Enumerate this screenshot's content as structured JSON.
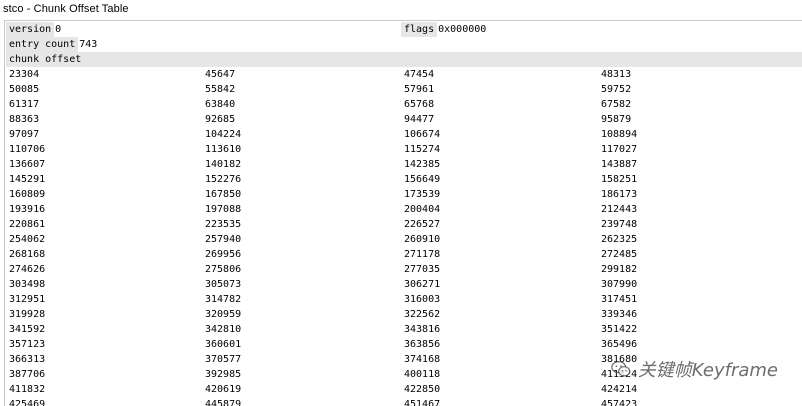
{
  "window": {
    "title": "stco - Chunk Offset Table"
  },
  "header": {
    "version_label": "version",
    "version_value": "0",
    "flags_label": "flags",
    "flags_value": "0x000000",
    "entry_count_label": "entry count",
    "entry_count_value": "743",
    "chunk_offset_label": "chunk offset"
  },
  "table": {
    "rows": [
      [
        "23304",
        "45647",
        "47454",
        "48313"
      ],
      [
        "50085",
        "55842",
        "57961",
        "59752"
      ],
      [
        "61317",
        "63840",
        "65768",
        "67582"
      ],
      [
        "88363",
        "92685",
        "94477",
        "95879"
      ],
      [
        "97097",
        "104224",
        "106674",
        "108894"
      ],
      [
        "110706",
        "113610",
        "115274",
        "117027"
      ],
      [
        "136607",
        "140182",
        "142385",
        "143887"
      ],
      [
        "145291",
        "152276",
        "156649",
        "158251"
      ],
      [
        "160809",
        "167850",
        "173539",
        "186173"
      ],
      [
        "193916",
        "197088",
        "200404",
        "212443"
      ],
      [
        "220861",
        "223535",
        "226527",
        "239748"
      ],
      [
        "254062",
        "257940",
        "260910",
        "262325"
      ],
      [
        "268168",
        "269956",
        "271178",
        "272485"
      ],
      [
        "274626",
        "275806",
        "277035",
        "299182"
      ],
      [
        "303498",
        "305073",
        "306271",
        "307990"
      ],
      [
        "312951",
        "314782",
        "316003",
        "317451"
      ],
      [
        "319928",
        "320959",
        "322562",
        "339346"
      ],
      [
        "341592",
        "342810",
        "343816",
        "351422"
      ],
      [
        "357123",
        "360601",
        "363856",
        "365496"
      ],
      [
        "366313",
        "370577",
        "374168",
        "381680"
      ],
      [
        "387706",
        "392985",
        "400118",
        "411324"
      ],
      [
        "411832",
        "420619",
        "422850",
        "424214"
      ],
      [
        "425469",
        "445879",
        "451467",
        "457423"
      ]
    ]
  },
  "watermark": {
    "text": "关键帧Keyframe",
    "icon": "wechat-icon"
  },
  "colors": {
    "header_bg": "#e6e6e6",
    "border": "#c9c9c9"
  }
}
